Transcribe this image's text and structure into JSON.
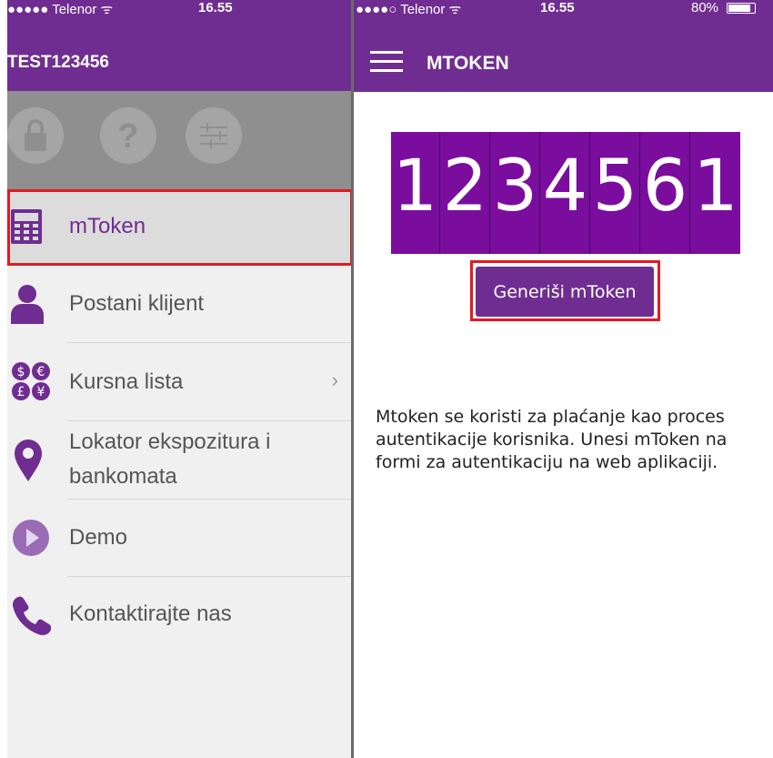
{
  "left_status": {
    "carrier": "●●●●● Telenor ᯤ",
    "time": "16.55"
  },
  "left_appbar": {
    "title": "TEST123456"
  },
  "icon_strip": [
    "lock-icon",
    "help-icon",
    "settings-sliders-icon"
  ],
  "menu": {
    "items": [
      {
        "label": "mToken",
        "icon": "calculator-icon",
        "active": true
      },
      {
        "label": "Postani klijent",
        "icon": "person-icon"
      },
      {
        "label": "Kursna lista",
        "icon": "currency-icon",
        "chevron": "›"
      },
      {
        "label_line1": "Lokator ekspozitura i",
        "label_line2": "bankomata",
        "icon": "location-pin-icon"
      },
      {
        "label": "Demo",
        "icon": "play-icon"
      },
      {
        "label": "Kontaktirajte nas",
        "icon": "phone-icon"
      }
    ]
  },
  "right_status": {
    "carrier": "●●●●○ Telenor ᯤ",
    "time": "16.55",
    "battery": "80%"
  },
  "right_appbar": {
    "title": "MTOKEN"
  },
  "token": {
    "digits": [
      "1",
      "2",
      "3",
      "4",
      "5",
      "6",
      "1"
    ]
  },
  "generate_button": {
    "label": "Generiši mToken"
  },
  "description": "Mtoken se koristi za plaćanje kao proces autentikacije korisnika. Unesi mToken na formi za autentikaciju na web aplikaciji.",
  "colors": {
    "brand_purple": "#6f2d91",
    "token_purple": "#7a0d9e",
    "highlight_red": "#e11a22"
  }
}
